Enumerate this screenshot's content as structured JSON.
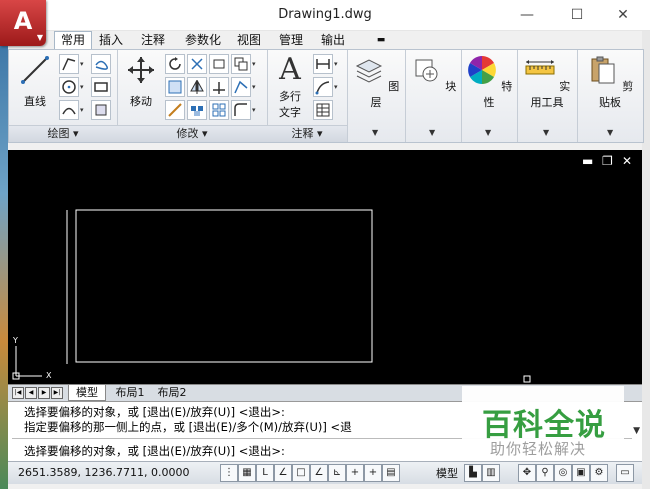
{
  "title": "Drawing1.dwg",
  "app_button_letter": "A",
  "tabs": [
    "常用",
    "插入",
    "注释",
    "参数化",
    "视图",
    "管理",
    "输出"
  ],
  "ribbon": {
    "draw": {
      "line_label": "直线",
      "panel_label": "绘图 ▾"
    },
    "modify": {
      "move_label": "移动",
      "panel_label": "修改 ▾"
    },
    "annotation": {
      "text_label_1": "多行",
      "text_label_2": "文字",
      "panel_label": "注释 ▾"
    },
    "layers": {
      "label": "图层"
    },
    "block": {
      "label": "块"
    },
    "properties": {
      "label": "特性"
    },
    "utilities": {
      "label": "实用工具"
    },
    "clipboard": {
      "label": "剪贴板"
    }
  },
  "canvas": {
    "controls": [
      "▬",
      "❐",
      "✕"
    ],
    "ucs_x": "X",
    "ucs_y": "Y"
  },
  "layout_tabs": [
    "模型",
    "布局1",
    "布局2"
  ],
  "command_lines": [
    "选择要偏移的对象，或 [退出(E)/放弃(U)] <退出>:",
    "指定要偏移的那一侧上的点，或 [退出(E)/多个(M)/放弃(U)] <退",
    "选择要偏移的对象，或 [退出(E)/放弃(U)] <退出>:"
  ],
  "status": {
    "coords": "2651.3589, 1236.7711, 0.0000",
    "model_label": "模型"
  },
  "watermark": {
    "title": "百科全说",
    "subtitle": "助你轻松解决"
  },
  "colors": {
    "canvas_bg": "#000000",
    "rect_stroke": "#ffffff",
    "app_red": "#c83232",
    "watermark_green": "#2e9b3a"
  }
}
